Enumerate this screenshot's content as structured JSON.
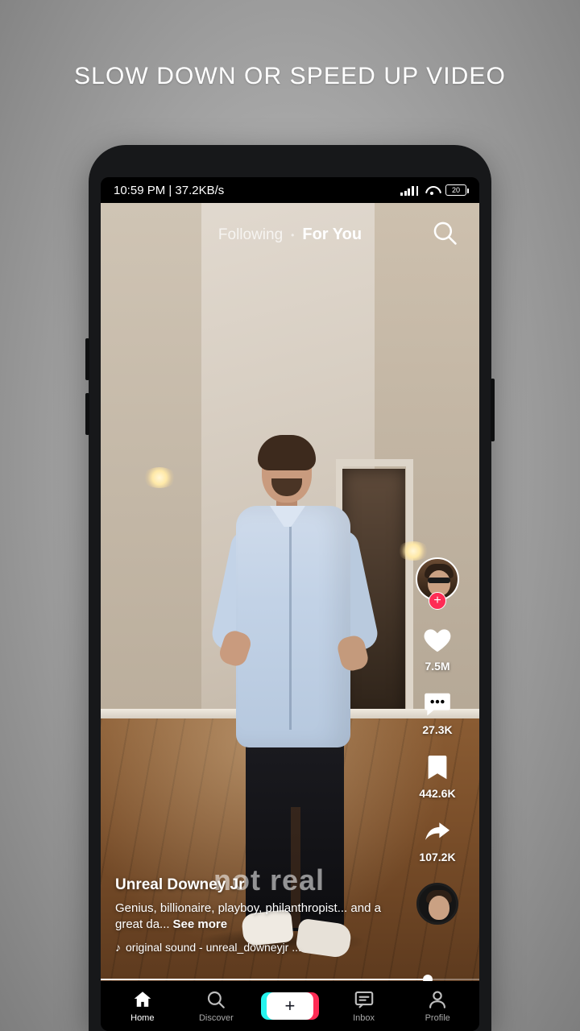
{
  "headline": "SLOW DOWN OR SPEED UP VIDEO",
  "status_bar": {
    "time_and_net": "10:59 PM | 37.2KB/s",
    "signal_icon": "cellular-signal-icon",
    "wifi_icon": "wifi-icon",
    "battery_level": "20"
  },
  "top_nav": {
    "following": "Following",
    "separator": "•",
    "for_you": "For You",
    "search_icon": "search-icon"
  },
  "video": {
    "watermark": "not real"
  },
  "right_rail": {
    "avatar_name": "creator-avatar",
    "follow_badge": "+",
    "actions": [
      {
        "icon": "heart-icon",
        "count": "7.5M"
      },
      {
        "icon": "comment-icon",
        "count": "27.3K"
      },
      {
        "icon": "bookmark-icon",
        "count": "442.6K"
      },
      {
        "icon": "share-icon",
        "count": "107.2K"
      }
    ],
    "sound_disc": "sound-disc-icon"
  },
  "caption": {
    "username": "Unreal Downey Jr",
    "description": "Genius, billionaire, playboy, philanthropist... and a great da...",
    "see_more": "See more",
    "music_icon": "music-note-icon",
    "music": "original sound - unreal_downeyjr ..."
  },
  "progress": {
    "percent": 87
  },
  "bottom_nav": {
    "items": [
      {
        "label": "Home",
        "icon": "home-icon",
        "active": true
      },
      {
        "label": "Discover",
        "icon": "search-icon",
        "active": false
      },
      {
        "label": "",
        "icon": "create-plus-icon",
        "active": false
      },
      {
        "label": "Inbox",
        "icon": "inbox-icon",
        "active": false
      },
      {
        "label": "Profile",
        "icon": "person-icon",
        "active": false
      }
    ],
    "create_label": "+"
  }
}
